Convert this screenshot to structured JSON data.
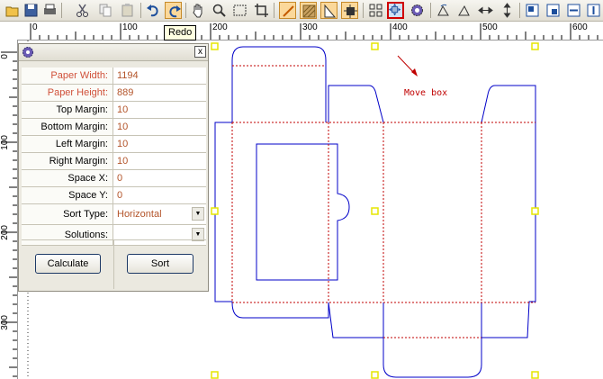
{
  "toolbar": {
    "tooltip": "Redo",
    "icons": [
      "open-icon",
      "save-icon",
      "print-icon",
      "cut-icon",
      "copy-icon",
      "paste-icon",
      "undo-icon",
      "redo-icon",
      "hand-icon",
      "zoom-icon",
      "select-rect-icon",
      "crop-icon",
      "line-tool-icon",
      "hatch-icon",
      "ruler-triangle-icon",
      "fit-icon",
      "grid-icon",
      "move-box-icon",
      "gear-icon",
      "rotate-left-icon",
      "rotate-right-icon",
      "mirror-horizontal-icon",
      "mirror-vertical-icon",
      "align-1-icon",
      "align-2-icon",
      "align-3-icon",
      "align-4-icon"
    ]
  },
  "ruler": {
    "top_labels": [
      "0",
      "100",
      "200",
      "300",
      "400",
      "500",
      "600"
    ],
    "left_labels": [
      "0",
      "100",
      "200",
      "300"
    ]
  },
  "panel": {
    "fields": [
      {
        "label": "Paper Width:",
        "value": "1194"
      },
      {
        "label": "Paper Height:",
        "value": "889"
      },
      {
        "label": "Top Margin:",
        "value": "10"
      },
      {
        "label": "Bottom Margin:",
        "value": "10"
      },
      {
        "label": "Left Margin:",
        "value": "10"
      },
      {
        "label": "Right Margin:",
        "value": "10"
      },
      {
        "label": "Space X:",
        "value": "0"
      },
      {
        "label": "Space Y:",
        "value": "0"
      }
    ],
    "sort_type_label": "Sort Type:",
    "sort_type_value": "Horizontal",
    "solutions_label": "Solutions:",
    "solutions_value": "",
    "calculate_label": "Calculate",
    "sort_label": "Sort",
    "close_glyph": "x"
  },
  "annotation": "Move box",
  "colors": {
    "die_line": "#0000c8",
    "fold_line": "#c00000",
    "handle": "#e6e600"
  }
}
